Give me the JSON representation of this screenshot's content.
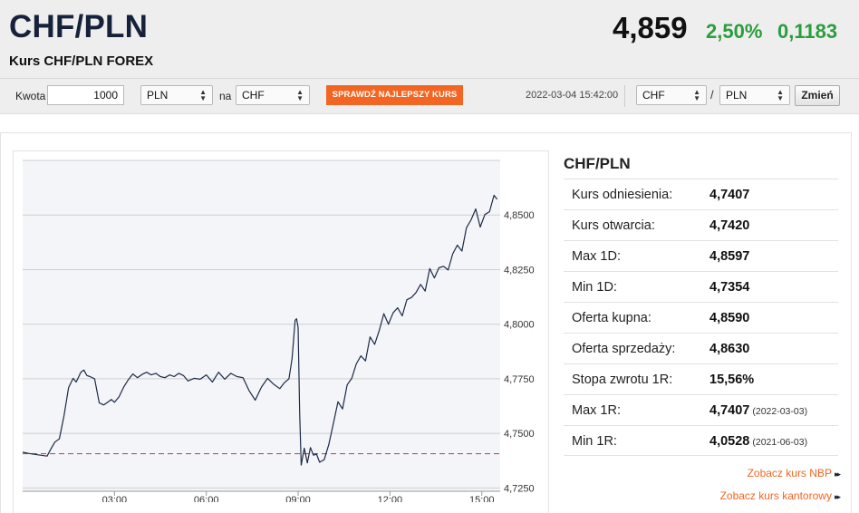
{
  "header": {
    "title": "CHF/PLN",
    "subtitle": "Kurs CHF/PLN FOREX",
    "price": "4,859",
    "change_pct": "2,50%",
    "change_abs": "0,1183",
    "change_color": "#2a9d3c"
  },
  "converter": {
    "amount_label": "Kwota",
    "amount_value": "1000",
    "from_currency": "PLN",
    "to_label": "na",
    "to_currency": "CHF",
    "check_button": "SPRAWDŹ NAJLEPSZY KURS",
    "timestamp": "2022-03-04 15:42:00",
    "pair_base": "CHF",
    "pair_separator": "/",
    "pair_quote": "PLN",
    "change_button": "Zmień"
  },
  "side": {
    "title": "CHF/PLN",
    "stats": [
      {
        "label": "Kurs odniesienia:",
        "value": "4,7407",
        "date": ""
      },
      {
        "label": "Kurs otwarcia:",
        "value": "4,7420",
        "date": ""
      },
      {
        "label": "Max 1D:",
        "value": "4,8597",
        "date": ""
      },
      {
        "label": "Min 1D:",
        "value": "4,7354",
        "date": ""
      },
      {
        "label": "Oferta kupna:",
        "value": "4,8590",
        "date": ""
      },
      {
        "label": "Oferta sprzedaży:",
        "value": "4,8630",
        "date": ""
      },
      {
        "label": "Stopa zwrotu 1R:",
        "value": "15,56%",
        "date": ""
      },
      {
        "label": "Max 1R:",
        "value": "4,7407",
        "date": "(2022-03-03)"
      },
      {
        "label": "Min 1R:",
        "value": "4,0528",
        "date": "(2021-06-03)"
      }
    ],
    "link_nbp": "Zobacz kurs NBP",
    "link_kantor": "Zobacz kurs kantorowy",
    "link_arrows": "▸▸",
    "accent": "#f26522"
  },
  "chart_data": {
    "type": "line",
    "y_ticks": [
      "4,8500",
      "4,8250",
      "4,8000",
      "4,7750",
      "4,7500",
      "4,7250"
    ],
    "y_tick_values": [
      4.85,
      4.825,
      4.8,
      4.775,
      4.75,
      4.725
    ],
    "x_ticks": [
      "03:00",
      "06:00",
      "09:00",
      "12:00",
      "15:00"
    ],
    "x_tick_values": [
      3,
      6,
      9,
      12,
      15
    ],
    "xlim": [
      0,
      15.6
    ],
    "ylim": [
      4.7235,
      4.875
    ],
    "reference_line": 4.7407,
    "reference_color": "#e0474c",
    "line_color": "#1c2b47",
    "grid": true,
    "series": [
      {
        "x": [
          0,
          0.2,
          0.5,
          0.8,
          0.9,
          1.05,
          1.2,
          1.35,
          1.5,
          1.65,
          1.75,
          1.9,
          2.0,
          2.1,
          2.2,
          2.35,
          2.5,
          2.65,
          2.8,
          2.9,
          3.0,
          3.15,
          3.3,
          3.45,
          3.6,
          3.75,
          3.9,
          4.05,
          4.2,
          4.35,
          4.5,
          4.65,
          4.8,
          4.95,
          5.1,
          5.25,
          5.4,
          5.6,
          5.8,
          6.0,
          6.2,
          6.4,
          6.6,
          6.8,
          7.0,
          7.2,
          7.4,
          7.6,
          7.8,
          8.0,
          8.2,
          8.4,
          8.55,
          8.7,
          8.8,
          8.9,
          8.95,
          9.0,
          9.05,
          9.1,
          9.2,
          9.3,
          9.4,
          9.5,
          9.6,
          9.7,
          9.85,
          10.0,
          10.15,
          10.3,
          10.45,
          10.6,
          10.75,
          10.9,
          11.05,
          11.2,
          11.35,
          11.5,
          11.65,
          11.8,
          11.95,
          12.1,
          12.25,
          12.4,
          12.55,
          12.7,
          12.85,
          13.0,
          13.15,
          13.3,
          13.45,
          13.6,
          13.75,
          13.9,
          14.05,
          14.2,
          14.35,
          14.5,
          14.65,
          14.8,
          14.95,
          15.1,
          15.25,
          15.4,
          15.5
        ],
        "y": [
          4.7414,
          4.7408,
          4.7402,
          4.7396,
          4.7423,
          4.746,
          4.7475,
          4.758,
          4.771,
          4.7752,
          4.7735,
          4.778,
          4.779,
          4.7765,
          4.776,
          4.775,
          4.764,
          4.763,
          4.7645,
          4.7655,
          4.7642,
          4.7668,
          4.7712,
          4.7745,
          4.7772,
          4.7755,
          4.777,
          4.778,
          4.7768,
          4.7775,
          4.776,
          4.7755,
          4.7768,
          4.776,
          4.7775,
          4.7765,
          4.774,
          4.7752,
          4.7748,
          4.7768,
          4.7735,
          4.778,
          4.7748,
          4.7775,
          4.776,
          4.7755,
          4.7695,
          4.7652,
          4.7712,
          4.7752,
          4.7725,
          4.7705,
          4.7732,
          4.775,
          4.7842,
          4.8018,
          4.8025,
          4.7985,
          4.7595,
          4.7355,
          4.7432,
          4.7365,
          4.7435,
          4.74,
          4.7405,
          4.7368,
          4.738,
          4.7448,
          4.7545,
          4.7645,
          4.7612,
          4.7722,
          4.7752,
          4.7818,
          4.7855,
          4.7832,
          4.7942,
          4.7908,
          4.7972,
          4.8048,
          4.8,
          4.8052,
          4.8075,
          4.8038,
          4.8112,
          4.8122,
          4.8145,
          4.8182,
          4.8152,
          4.8255,
          4.8212,
          4.8258,
          4.8265,
          4.8248,
          4.8322,
          4.8362,
          4.8335,
          4.8442,
          4.8478,
          4.8528,
          4.8445,
          4.8502,
          4.8515,
          4.859,
          4.8572
        ]
      }
    ]
  }
}
